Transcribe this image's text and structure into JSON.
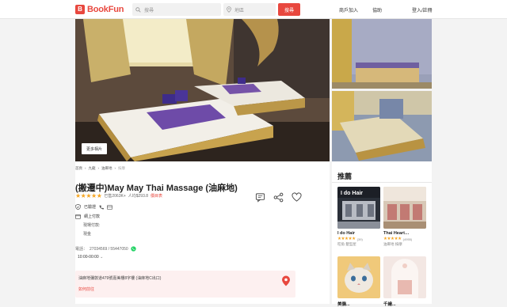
{
  "header": {
    "logo_mark": "B",
    "logo_text": "BookFun",
    "search_placeholder": "搜尋",
    "location_placeholder": "地區",
    "search_button": "搜尋",
    "nav": {
      "merchant": "商戶加入",
      "help": "協助",
      "login": "登入/註冊"
    }
  },
  "gallery": {
    "more_photos": "更多相片"
  },
  "breadcrumb": [
    "首頁",
    "九龍",
    "油麻地",
    "按摩"
  ],
  "listing": {
    "title": "(搬遷中)May May Thai Massage (油麻地)",
    "stars": "★★★★★",
    "rating_text": "已售2063K+",
    "price_text": "人均$293.8",
    "bookmark": "價目表",
    "verified": "已驗證",
    "payment_online": "網上付款",
    "payment_onsite": "現場付款:",
    "payment_method": "現金",
    "phone_label": "電話：",
    "phone": "27034569 / 55447050",
    "hours": "10:00-00:00",
    "address": "油麻地彌敦道479號嘉美樓8字樓 (油麻地C出口)",
    "directions": "如何前往"
  },
  "sidebar": {
    "title": "推薦",
    "cards": [
      {
        "name": "I do Hair",
        "stars": "★★★★★",
        "count": "(39)",
        "location": "旺角 髮型屋"
      },
      {
        "name": "Thai Heart…",
        "stars": "★★★★★",
        "count": "(4955)",
        "location": "油麻地 按摩"
      },
      {
        "name": "美貓...",
        "stars": "",
        "count": "",
        "location": ""
      },
      {
        "name": "千繪...",
        "stars": "",
        "count": "",
        "location": ""
      }
    ]
  },
  "colors": {
    "brand": "#e8483f",
    "star": "#f5a623",
    "address_bg": "#fdf0f0"
  }
}
